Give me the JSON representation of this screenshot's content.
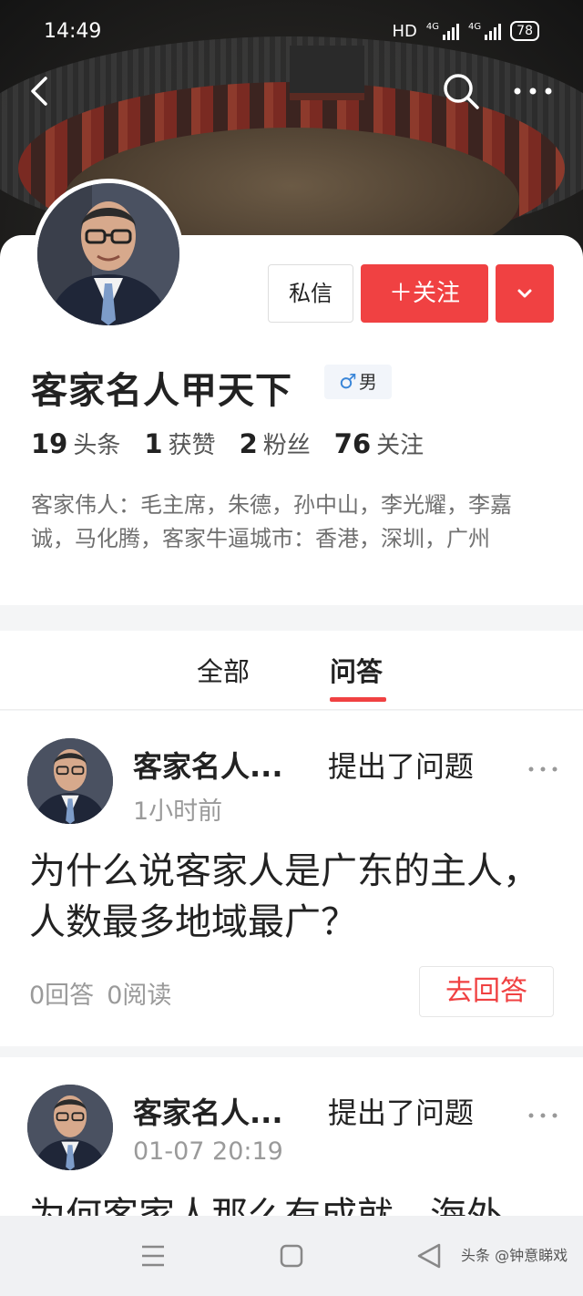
{
  "status_bar": {
    "time": "14:49",
    "hd": "HD",
    "network_1": "4G",
    "network_2": "4G",
    "battery": "78"
  },
  "profile": {
    "name": "客家名人甲天下",
    "gender_symbol": "♂",
    "gender_label": "男",
    "stats": [
      {
        "value": "19",
        "label": "头条"
      },
      {
        "value": "1",
        "label": "获赞"
      },
      {
        "value": "2",
        "label": "粉丝"
      },
      {
        "value": "76",
        "label": "关注"
      }
    ],
    "bio": "客家伟人：毛主席，朱德，孙中山，李光耀，李嘉诚，马化腾，客家牛逼城市：香港，深圳，广州",
    "message_button": "私信",
    "follow_button": "＋关注"
  },
  "tabs": [
    {
      "label": "全部",
      "active": false
    },
    {
      "label": "问答",
      "active": true
    }
  ],
  "posts": [
    {
      "author": "客家名人...",
      "action": "提出了问题",
      "time": "1小时前",
      "title": "为什么说客家人是广东的主人，人数最多地域最广？",
      "answers": "0回答",
      "reads": "0阅读",
      "answer_button": "去回答"
    },
    {
      "author": "客家名人...",
      "action": "提出了问题",
      "time": "01-07 20:19",
      "title": "为何客家人那么有成就，海外"
    }
  ],
  "watermark": "头条 @钟意睇戏",
  "colors": {
    "accent": "#f04142",
    "muted_text": "#9a9a9a",
    "gender_icon": "#3a86d8"
  },
  "icons": [
    "back-arrow-icon",
    "search-icon",
    "more-dots-icon",
    "chevron-down-icon",
    "menu-lines-icon",
    "home-square-icon",
    "back-triangle-icon"
  ]
}
